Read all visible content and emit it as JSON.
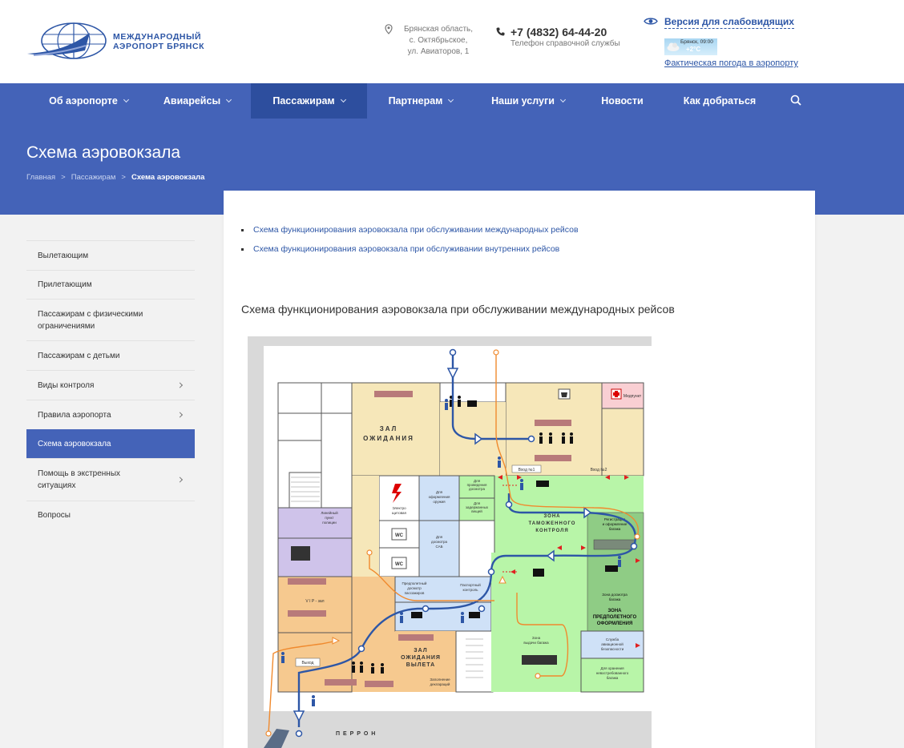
{
  "header": {
    "logo_line1": "МЕЖДУНАРОДНЫЙ",
    "logo_line2": "АЭРОПОРТ БРЯНСК",
    "address_lines": [
      "Брянская область,",
      "с. Октябрьское,",
      "ул. Авиаторов, 1"
    ],
    "phone": "+7 (4832) 64-44-20",
    "phone_note": "Телефон справочной службы",
    "accessibility_link": "Версия для слабовидящих",
    "weather_city": "Брянск, 09:00",
    "weather_temp": "+2°C",
    "weather_link": "Фактическая погода в аэропорту"
  },
  "nav": {
    "items": [
      {
        "label": "Об аэропорте"
      },
      {
        "label": "Авиарейсы"
      },
      {
        "label": "Пассажирам"
      },
      {
        "label": "Партнерам"
      },
      {
        "label": "Наши услуги"
      },
      {
        "label": "Новости"
      },
      {
        "label": "Как добраться"
      }
    ]
  },
  "banner": {
    "title": "Схема аэровокзала",
    "breadcrumb": [
      "Главная",
      "Пассажирам",
      "Схема аэровокзала"
    ]
  },
  "sidebar": {
    "items": [
      {
        "label": "Вылетающим"
      },
      {
        "label": "Прилетающим"
      },
      {
        "label": "Пассажирам с физическими ограничениями"
      },
      {
        "label": "Пассажирам с детьми"
      },
      {
        "label": "Виды контроля"
      },
      {
        "label": "Правила аэропорта"
      },
      {
        "label": "Схема аэровокзала"
      },
      {
        "label": "Помощь в экстренных ситуациях"
      },
      {
        "label": "Вопросы"
      }
    ]
  },
  "main": {
    "links": [
      "Схема функционирования аэровокзала при обслуживании международных рейсов",
      "Схема функционирования аэровокзала при обслуживании внутренних рейсов"
    ],
    "section_title": "Схема функционирования аэровокзала при обслуживании международных рейсов",
    "scheme": {
      "zal_ozhidaniya_1": "ЗАЛ",
      "zal_ozhidaniya_2": "ОЖИДАНИЯ",
      "medpunkt": "Медпункт",
      "vhod1": "Вход №1",
      "vhod2": "Вход №2",
      "oform_oruzh": [
        "Для",
        "оформления",
        "оружия"
      ],
      "dosmotr": [
        "Для",
        "проведения",
        "досмотра"
      ],
      "zaderzh": [
        "Для",
        "задержанных",
        "вещей"
      ],
      "elektro": [
        "Электро",
        "щитовая"
      ],
      "wc": "WC",
      "dosmotr_sab": [
        "Для",
        "досмотра",
        "САБ"
      ],
      "lineyny": [
        "Линейный",
        "пункт",
        "полиции"
      ],
      "vip": "V I P - зал",
      "zona_tam_1": "ЗОНА",
      "zona_tam_2": "ТАМОЖЕННОГО",
      "zona_tam_3": "КОНТРОЛЯ",
      "registr": [
        "Регистрация",
        "и оформление",
        "багажа"
      ],
      "zona_dosm_bag": [
        "Зона досмотра",
        "багажа"
      ],
      "predpol_dosm": [
        "Предполетный",
        "досмотр",
        "пассажиров"
      ],
      "pasp_kontr": [
        "Паспортный",
        "контроль"
      ],
      "zona_predpol_1": "ЗОНА",
      "zona_predpol_2": "ПРЕДПОЛЕТНОГО",
      "zona_predpol_3": "ОФОРМЛЕНИЯ",
      "zona_vydachi": [
        "Зона",
        "выдачи багажа"
      ],
      "sluzhba_ab": [
        "Служба",
        "авиационной",
        "безопасности"
      ],
      "hranenie": [
        "Для хранения",
        "невостребованного",
        "багажа"
      ],
      "zal_vyl_1": "ЗАЛ",
      "zal_vyl_2": "ОЖИДАНИЯ",
      "zal_vyl_3": "ВЫЛЕТА",
      "vyhod": "Выход",
      "zapolnenie": [
        "Заполнение",
        "деклараций"
      ],
      "perron": "П Е Р Р О Н"
    }
  },
  "colors": {
    "brand_blue": "#4463b8",
    "nav_active": "#2d4e9e",
    "link_blue": "#2d56a6",
    "zone_beige": "#f6e7b9",
    "zone_green": "#b8f5a8",
    "zone_orange": "#f6c98f",
    "zone_blue": "#cfe1f7",
    "zone_purple": "#cfc3ea",
    "route_blue": "#2d56a6",
    "route_orange": "#f08a2e"
  }
}
